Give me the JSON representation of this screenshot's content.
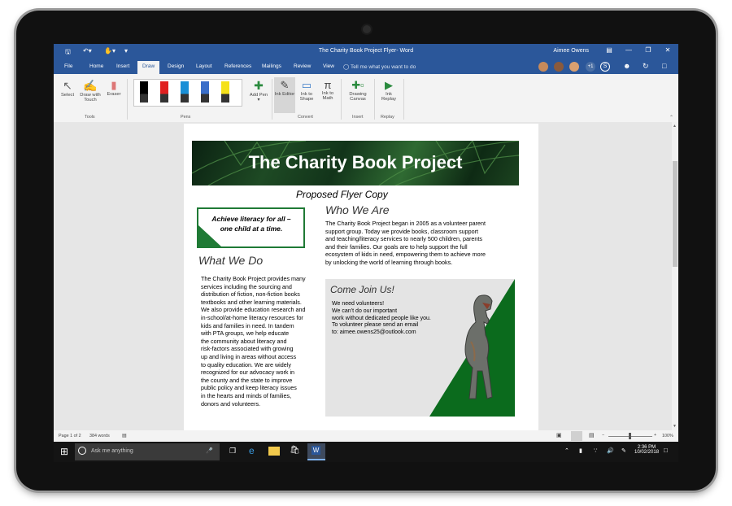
{
  "window": {
    "title": "The Charity Book Project Flyer- Word",
    "user": "Aimee Owens"
  },
  "tabs": [
    "File",
    "Home",
    "Insert",
    "Draw",
    "Design",
    "Layout",
    "References",
    "Mailings",
    "Review",
    "View"
  ],
  "active_tab": "Draw",
  "tell_me": "Tell me what you want to do",
  "ribbon": {
    "tools": {
      "select": "Select",
      "draw_with_touch": "Draw with Touch",
      "eraser": "Eraser",
      "group": "Tools"
    },
    "pens": {
      "group": "Pens",
      "add_pen": "Add Pen"
    },
    "convert": {
      "ink_editor": "Ink Editor",
      "ink_to_shape": "Ink to Shape",
      "ink_to_math": "Ink to Math",
      "group": "Convert"
    },
    "insert": {
      "drawing_canvas": "Drawing Canvas",
      "group": "Insert"
    },
    "replay": {
      "ink_replay": "Ink Replay",
      "group": "Replay"
    }
  },
  "document": {
    "banner_title": "The Charity Book Project",
    "subtitle": "Proposed Flyer Copy",
    "quote_line1": "Achieve literacy for all –",
    "quote_line2": "one child at a time.",
    "who_heading": "Who We Are",
    "who_lines": [
      "The Charity Book Project began in 2005 as a volunteer parent",
      "support group.  Today we provide books, classroom support",
      "and teaching/literacy services to nearly 500 children, parents",
      "and their families. Our goals are to help support the full",
      "ecosystem of kids in need, empowering them to achieve more",
      "by unlocking the world of learning through books."
    ],
    "what_heading": "What We Do",
    "what_lines": [
      "The Charity Book Project provides many",
      "services including the sourcing and",
      "distribution of fiction, non-fiction books",
      "textbooks and other learning materials.",
      "We also provide education research and",
      "in-school/at-home literacy resources for",
      "kids and families in need. In tandem",
      "with PTA groups, we help educate",
      "the community about literacy and",
      "risk-factors associated with growing",
      "up and living in areas without access",
      "to quality education. We are widely",
      "recognized for our advocacy work in",
      "the county and the state to improve",
      "public policy and keep literacy issues",
      "in the hearts and minds of families,",
      "donors and volunteers."
    ],
    "join_heading": "Come Join Us!",
    "join_lines": [
      "We need volunteers!",
      "We can’t do our important",
      "work without dedicated people like you.",
      "To volunteer please send an email",
      "to: aimee.owens25@outlook.com"
    ]
  },
  "status": {
    "page": "Page 1 of 2",
    "words": "384 words",
    "zoom": "100%"
  },
  "taskbar": {
    "search_placeholder": "Ask me anything",
    "time": "2:36 PM",
    "date": "10/02/2018"
  },
  "colors": {
    "word_blue": "#2b579a",
    "accent_green": "#1f7a35",
    "dark_green": "#0b6b1d"
  }
}
